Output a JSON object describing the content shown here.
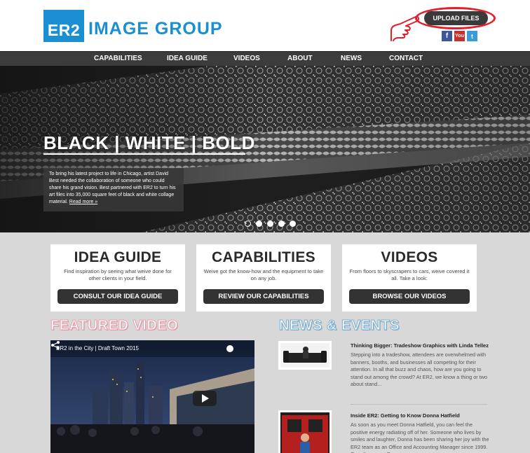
{
  "brand": {
    "logo_box": "ER2",
    "logo_text": "IMAGE GROUP",
    "color": "#1a8fd1"
  },
  "header": {
    "upload_label": "UPLOAD FILES",
    "social": [
      {
        "name": "facebook-icon",
        "glyph": "f"
      },
      {
        "name": "youtube-icon",
        "glyph": "You"
      },
      {
        "name": "twitter-icon",
        "glyph": "t"
      }
    ]
  },
  "nav": {
    "items": [
      "CAPABILITIES",
      "IDEA GUIDE",
      "VIDEOS",
      "ABOUT",
      "NEWS",
      "CONTACT"
    ]
  },
  "hero": {
    "title": "BLACK | WHITE | BOLD",
    "caption": "To bring his latest project to life in Chicago, artist David Best needed the collaboration of someone who could share his grand vision. Best partnered with ER2 to turn his art files into 35,000 square feet of black and white collage material.",
    "read_more": "Read more »",
    "slide_count": 5,
    "active_slide": 1
  },
  "promos": [
    {
      "title": "IDEA GUIDE",
      "text": "Find inspiration by seeing what weive done for other clients in your field.",
      "button": "CONSULT OUR IDEA GUIDE"
    },
    {
      "title": "CAPABILITIES",
      "text": "Weive got the know-how and the equipment to take on any job.",
      "button": "REVIEW OUR CAPABILITIES"
    },
    {
      "title": "VIDEOS",
      "text": "From floors to skyscrapers to cars, weive covered it all. Take a look:",
      "button": "BROWSE OUR VIDEOS"
    }
  ],
  "featured": {
    "heading": "FEATURED VIDEO",
    "video_title": "ER2 in the City | Draft Town 2015"
  },
  "news": {
    "heading": "NEWS & EVENTS",
    "items": [
      {
        "title": "Thinking Bigger: Tradeshow Graphics with Linda Tellez",
        "excerpt": "Stepping into a tradeshow, attendees are overwhelmed with banners, booths, and businesses all competing for their attention. In all that buzz and chaos, how are you going to stand out among the crowd? At ER2, we know a thing or two about stand..."
      },
      {
        "title": "Inside ER2: Getting to Know Donna Hatfield",
        "excerpt": "As soon as you meet Donna Hatfield, you can feel the positive energy radiating off of her. Someone who lives by smiles and laughter, Donna has been sharing her joy with the ER2 team as an Office and Accounting Manager since 1999. Over the years, Donna..."
      }
    ]
  }
}
